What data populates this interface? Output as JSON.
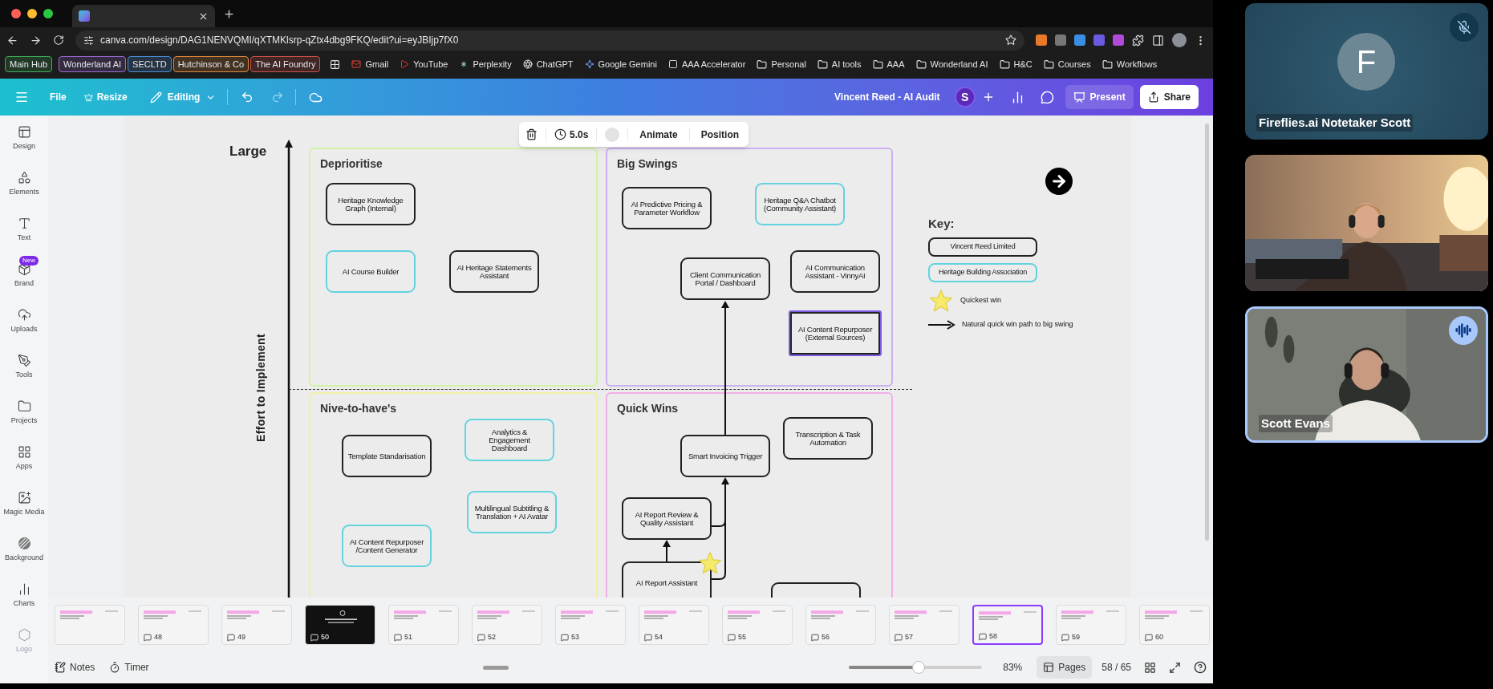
{
  "browser": {
    "url": "canva.com/design/DAG1NENVQMI/qXTMKlsrp-qZtx4dbg9FKQ/edit?ui=eyJBIjp7fX0"
  },
  "bookmarks": [
    {
      "kind": "tag",
      "label": "Main Hub",
      "color": "#3fae5a"
    },
    {
      "kind": "tag",
      "label": "Wonderland AI",
      "color": "#9a6ad6"
    },
    {
      "kind": "tag",
      "label": "SECLTD",
      "color": "#4a8fe0"
    },
    {
      "kind": "tag",
      "label": "Hutchinson & Co",
      "color": "#e08a3a"
    },
    {
      "kind": "tag",
      "label": "The AI Foundry",
      "color": "#d0504a"
    },
    {
      "kind": "apps"
    },
    {
      "kind": "site",
      "label": "Gmail"
    },
    {
      "kind": "site",
      "label": "YouTube"
    },
    {
      "kind": "site",
      "label": "Perplexity"
    },
    {
      "kind": "site",
      "label": "ChatGPT"
    },
    {
      "kind": "site",
      "label": "Google Gemini"
    },
    {
      "kind": "site",
      "label": "AAA Accelerator"
    },
    {
      "kind": "folder",
      "label": "Personal"
    },
    {
      "kind": "folder",
      "label": "AI tools"
    },
    {
      "kind": "folder",
      "label": "AAA"
    },
    {
      "kind": "folder",
      "label": "Wonderland AI"
    },
    {
      "kind": "folder",
      "label": "H&C"
    },
    {
      "kind": "folder",
      "label": "Courses"
    },
    {
      "kind": "folder",
      "label": "Workflows"
    }
  ],
  "editor": {
    "file": "File",
    "resize": "Resize",
    "mode": "Editing",
    "title": "Vincent Reed - AI Audit",
    "avatar": "S",
    "present": "Present",
    "share": "Share"
  },
  "sidebar": [
    {
      "label": "Design"
    },
    {
      "label": "Elements"
    },
    {
      "label": "Text"
    },
    {
      "label": "Brand",
      "badge": "New"
    },
    {
      "label": "Uploads"
    },
    {
      "label": "Tools"
    },
    {
      "label": "Projects"
    },
    {
      "label": "Apps"
    },
    {
      "label": "Magic Media"
    },
    {
      "label": "Background"
    },
    {
      "label": "Charts"
    },
    {
      "label": "Logo"
    }
  ],
  "element_toolbar": {
    "duration": "5.0s",
    "buttons": [
      "Animate",
      "Position"
    ]
  },
  "diagram": {
    "top_label": "Large",
    "axis_label": "Effort to Implement",
    "quadrants": [
      {
        "title": "Deprioritise",
        "color": "#d2f2a4",
        "items": [
          {
            "label": "Heritage Knowledge Graph (Internal)",
            "kind": "vincent",
            "selected": false,
            "quickest_win": false
          },
          {
            "label": "AI Course Builder",
            "kind": "heritage",
            "selected": false,
            "quickest_win": false
          },
          {
            "label": "AI Heritage Statements Assistant",
            "kind": "vincent",
            "selected": false,
            "quickest_win": false
          }
        ]
      },
      {
        "title": "Big Swings",
        "color": "#cdb0f2",
        "items": [
          {
            "label": "AI Predictive Pricing & Parameter Workflow",
            "kind": "vincent",
            "selected": false,
            "quickest_win": false
          },
          {
            "label": "Heritage Q&A Chatbot (Community Assistant)",
            "kind": "heritage",
            "selected": false,
            "quickest_win": false
          },
          {
            "label": "Client Communication Portal / Dashboard",
            "kind": "vincent",
            "selected": false,
            "quickest_win": false
          },
          {
            "label": "AI Communication Assistant - VinnyAI",
            "kind": "vincent",
            "selected": false,
            "quickest_win": false
          },
          {
            "label": "AI Content Repurposer (External Sources)",
            "kind": "vincent",
            "selected": true,
            "quickest_win": false
          }
        ]
      },
      {
        "title": "Nive-to-have's",
        "color": "#eef0a6",
        "items": [
          {
            "label": "Template Standarisation",
            "kind": "vincent",
            "selected": false,
            "quickest_win": false
          },
          {
            "label": "Analytics & Engagement Dashboard",
            "kind": "heritage",
            "selected": false,
            "quickest_win": false
          },
          {
            "label": "Multilingual Subtitling & Translation + AI Avatar",
            "kind": "heritage",
            "selected": false,
            "quickest_win": false
          },
          {
            "label": "AI Content Repurposer /Content Generator",
            "kind": "heritage",
            "selected": false,
            "quickest_win": false
          }
        ]
      },
      {
        "title": "Quick Wins",
        "color": "#f2b0e6",
        "items": [
          {
            "label": "Smart Invoicing Trigger",
            "kind": "vincent",
            "selected": false,
            "quickest_win": false
          },
          {
            "label": "Transcription & Task Automation",
            "kind": "vincent",
            "selected": false,
            "quickest_win": false
          },
          {
            "label": "AI Report Review & Quality Assistant",
            "kind": "vincent",
            "selected": false,
            "quickest_win": false
          },
          {
            "label": "AI Report Assistant",
            "kind": "vincent",
            "selected": false,
            "quickest_win": true
          },
          {
            "kind": "vincent",
            "selected": false,
            "quickest_win": false
          }
        ]
      }
    ],
    "key": {
      "title": "Key:",
      "entries": [
        {
          "kind": "vincent",
          "label": "Vincent Reed Limited"
        },
        {
          "kind": "heritage",
          "label": "Heritage Building Association"
        },
        {
          "kind": "star",
          "label": "Quickest win"
        },
        {
          "kind": "arrow",
          "label": "Natural quick win path to big swing"
        }
      ]
    }
  },
  "thumbnails": [
    {
      "kind": "light",
      "selected": false
    },
    {
      "kind": "light",
      "number": "48",
      "selected": false
    },
    {
      "kind": "light",
      "number": "49",
      "selected": false
    },
    {
      "kind": "dark",
      "number": "50",
      "selected": false
    },
    {
      "kind": "light",
      "number": "51",
      "selected": false
    },
    {
      "kind": "light",
      "number": "52",
      "selected": false
    },
    {
      "kind": "light",
      "number": "53",
      "selected": false
    },
    {
      "kind": "light",
      "number": "54",
      "selected": false
    },
    {
      "kind": "light",
      "number": "55",
      "selected": false
    },
    {
      "kind": "light",
      "number": "56",
      "selected": false
    },
    {
      "kind": "light",
      "number": "57",
      "selected": false
    },
    {
      "kind": "light",
      "number": "58",
      "selected": true
    },
    {
      "kind": "light",
      "number": "59",
      "selected": false
    },
    {
      "kind": "light",
      "number": "60",
      "selected": false
    }
  ],
  "footer": {
    "notes": "Notes",
    "timer": "Timer",
    "zoom": {
      "level": 0.52,
      "reading": "83%"
    },
    "pages": "Pages",
    "page_count": "58 / 65"
  },
  "call": [
    {
      "kind": "avatar",
      "initial": "F",
      "name": "Fireflies.ai Notetaker Scott",
      "muted": true,
      "speaking": false
    },
    {
      "kind": "video",
      "muted": false,
      "speaking": false
    },
    {
      "kind": "video",
      "name": "Scott Evans",
      "muted": false,
      "speaking": true
    }
  ]
}
